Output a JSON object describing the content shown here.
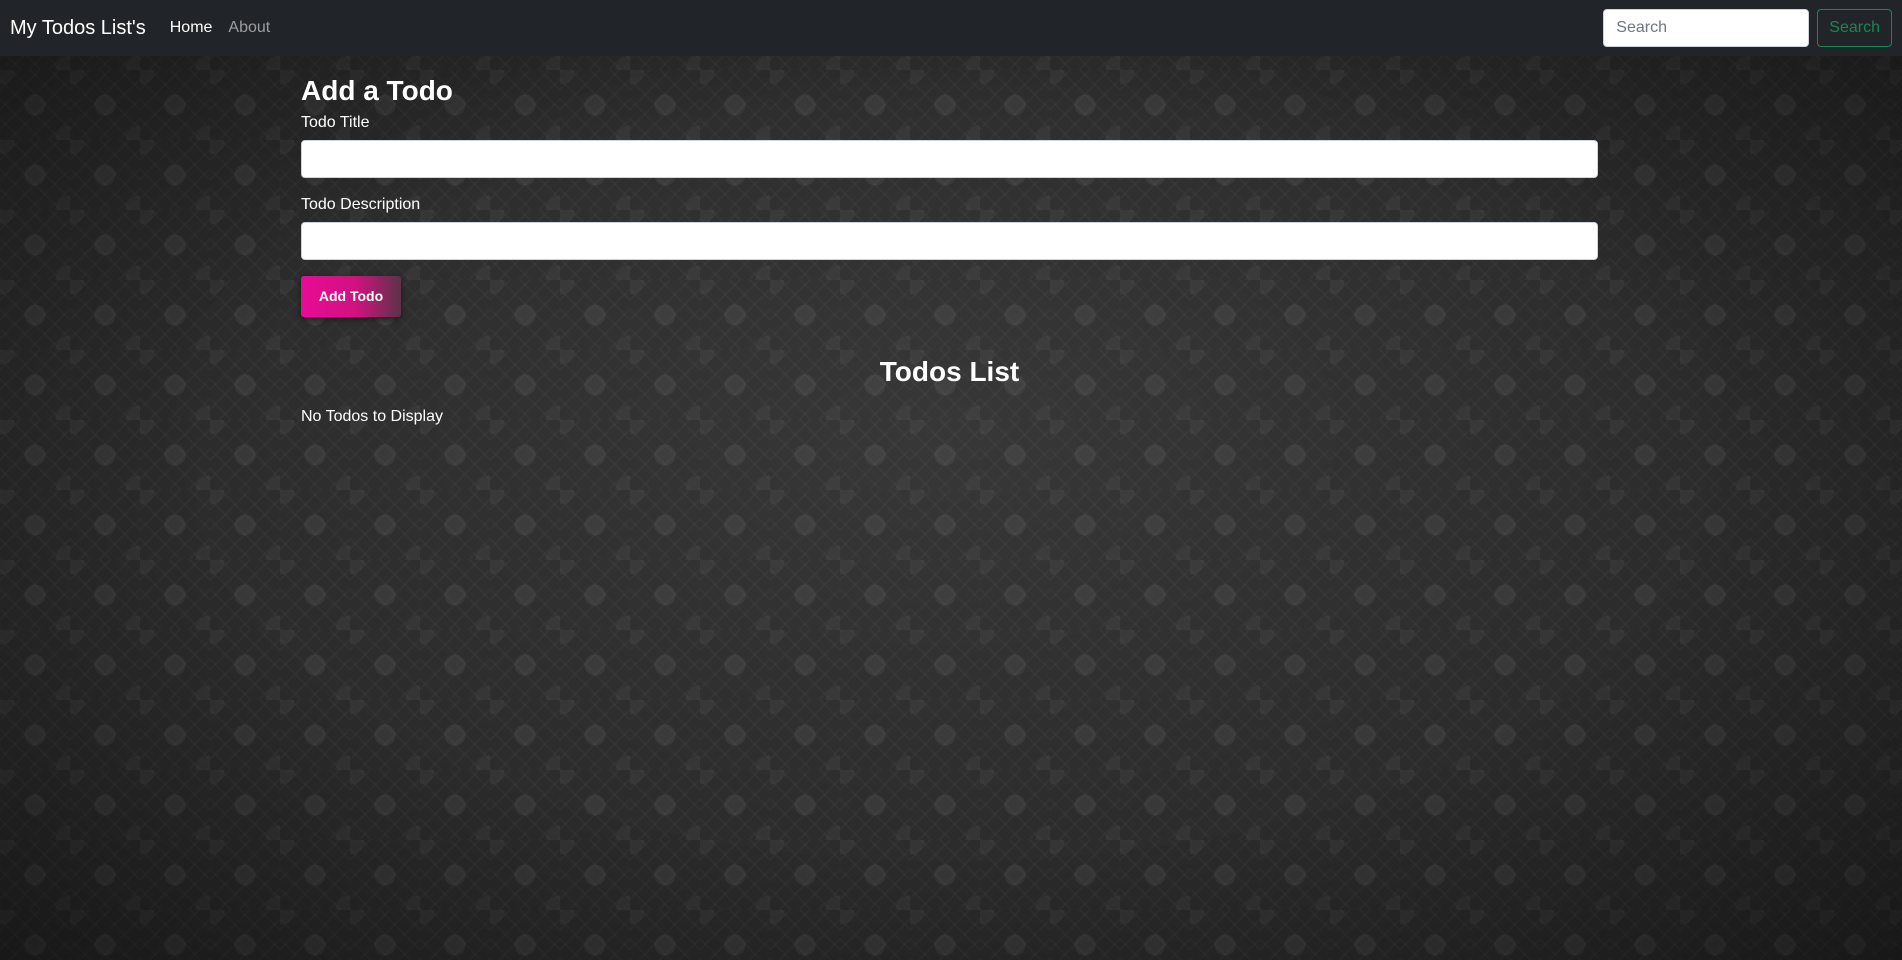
{
  "navbar": {
    "brand": "My Todos List's",
    "links": [
      {
        "label": "Home",
        "active": true
      },
      {
        "label": "About",
        "active": false
      }
    ],
    "search": {
      "placeholder": "Search",
      "value": "",
      "button_label": "Search"
    }
  },
  "form": {
    "title": "Add a Todo",
    "title_field": {
      "label": "Todo Title",
      "value": ""
    },
    "description_field": {
      "label": "Todo Description",
      "value": ""
    },
    "submit_label": "Add Todo"
  },
  "todos": {
    "title": "Todos List",
    "empty_message": "No Todos to Display",
    "items": []
  },
  "colors": {
    "navbar_bg": "#212529",
    "search_button": "#198754",
    "add_button_start": "#e80b97",
    "add_button_end": "#5a3349"
  }
}
